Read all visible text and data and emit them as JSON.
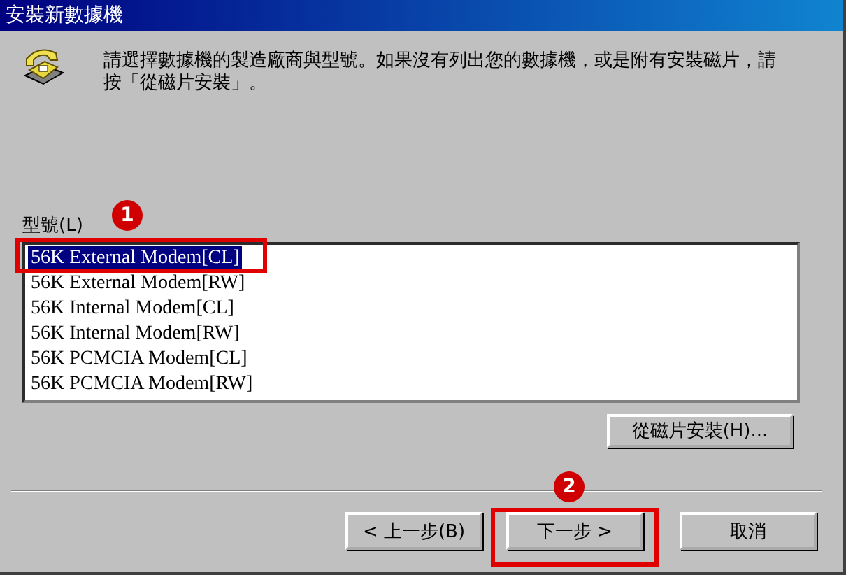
{
  "window": {
    "title": "安裝新數據機"
  },
  "instruction": "請選擇數據機的製造廠商與型號。如果沒有列出您的數據機，或是附有安裝磁片，請按「從磁片安裝」。",
  "models": {
    "label": "型號(L)",
    "items": [
      {
        "text": "56K External Modem[CL]",
        "selected": true
      },
      {
        "text": "56K External Modem[RW]",
        "selected": false
      },
      {
        "text": "56K Internal Modem[CL]",
        "selected": false
      },
      {
        "text": "56K Internal Modem[RW]",
        "selected": false
      },
      {
        "text": "56K PCMCIA Modem[CL]",
        "selected": false
      },
      {
        "text": "56K PCMCIA Modem[RW]",
        "selected": false
      }
    ]
  },
  "have_disk_button": "從磁片安裝(H)...",
  "buttons": [
    {
      "label": "< 上一步(B)"
    },
    {
      "label": "下一步 >"
    },
    {
      "label": "取消"
    }
  ],
  "callouts": [
    {
      "number": "1"
    },
    {
      "number": "2"
    }
  ]
}
